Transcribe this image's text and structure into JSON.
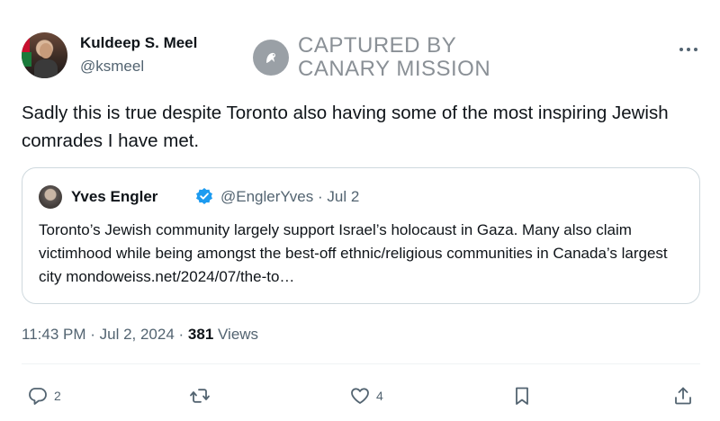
{
  "tweet": {
    "author_name": "Kuldeep S. Meel",
    "author_handle": "@ksmeel",
    "text": "Sadly this is true despite Toronto also having some of the most inspiring Jewish comrades I have met.",
    "timestamp": "11:43 PM · Jul 2, 2024 · ",
    "views_count": "381",
    "views_label": " Views"
  },
  "watermark": {
    "line1": "CAPTURED BY",
    "line2": "CANARY MISSION"
  },
  "quote": {
    "author_name": "Yves Engler",
    "handle_date": "@EnglerYves · Jul 2",
    "text": "Toronto’s Jewish community largely support Israel’s holocaust in Gaza. Many also claim victimhood while being amongst the best-off ethnic/religious communities in Canada’s largest city mondoweiss.net/2024/07/the-to…"
  },
  "actions": {
    "reply_count": "2",
    "repost_count": "",
    "like_count": "4"
  },
  "icons": {
    "more": "more-horizontal-icon",
    "reply": "reply-icon",
    "repost": "repost-icon",
    "like": "heart-icon",
    "bookmark": "bookmark-icon",
    "share": "share-icon",
    "verified": "verified-badge-icon"
  },
  "colors": {
    "text": "#0f1419",
    "secondary": "#536471",
    "border": "#cfd9de",
    "verified": "#1d9bf0",
    "watermark": "#8a9096"
  }
}
